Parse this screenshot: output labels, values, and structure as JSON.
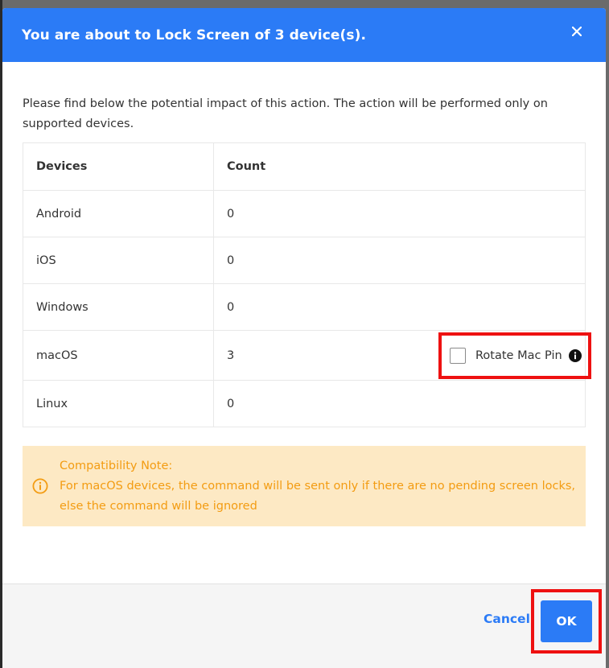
{
  "dialog": {
    "title": "You are about to Lock Screen of 3 device(s).",
    "close_icon": "close-icon",
    "intro": "Please find below the potential impact of this action. The action will be performed only on supported devices."
  },
  "table": {
    "headers": [
      "Devices",
      "Count"
    ],
    "rows": [
      {
        "device": "Android",
        "count": "0"
      },
      {
        "device": "iOS",
        "count": "0"
      },
      {
        "device": "Windows",
        "count": "0"
      },
      {
        "device": "macOS",
        "count": "3"
      },
      {
        "device": "Linux",
        "count": "0"
      }
    ],
    "rotate_mac_pin": {
      "label": "Rotate Mac Pin",
      "checked": false,
      "icon": "info-icon"
    }
  },
  "note": {
    "title": "Compatibility Note:",
    "text": "For macOS devices, the command will be sent only if there are no pending screen locks, else the command will be ignored",
    "icon": "info-circle-icon"
  },
  "footer": {
    "cancel_label": "Cancel",
    "ok_label": "OK"
  },
  "colors": {
    "primary": "#2b7bf6",
    "note_bg": "#fde9c4",
    "note_text": "#f39c12",
    "highlight": "#ee1111"
  }
}
